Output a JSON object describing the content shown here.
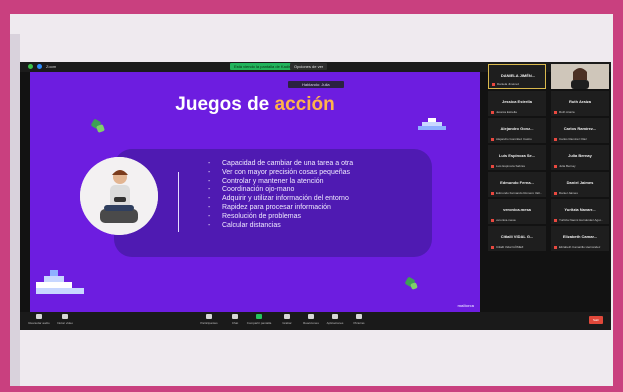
{
  "zoom": {
    "meeting_info": "Zoom",
    "share_banner": "Está viendo la pantalla de Kadiraliyah",
    "view_options": "Opciones de ver",
    "view_label": "Vista",
    "speaker_tag": "Hablando: Julia",
    "toolbar": {
      "items": [
        "Reanudar audio",
        "Iniciar video",
        "Participantes",
        "Chat",
        "Compartir pantalla",
        "Grabar",
        "Reacciones",
        "Aplicaciones",
        "Pizarras"
      ],
      "end": "Salir"
    }
  },
  "slide": {
    "title_main": "Juegos de ",
    "title_accent": "acción",
    "bullets": [
      "Capacidad de cambiar de una tarea a otra",
      "Ver con mayor precisión cosas pequeñas",
      "Controlar y mantener la atención",
      "Coordinación ojo-mano",
      "Adquirir y utilizar información del entorno",
      "Rapidez para procesar información",
      "Resolución de problemas",
      "Calcular distancias"
    ],
    "watermark": "mallorca"
  },
  "gallery": {
    "tiles": [
      {
        "name": "DANIELA JIMÉN...",
        "sub": "Daniela Jiménez"
      },
      {
        "name": "",
        "sub": ""
      },
      {
        "name": "Jessica Estrella",
        "sub": "Jessica Estrella"
      },
      {
        "name": "Ruth Araiza",
        "sub": "Ruth Araiza"
      },
      {
        "name": "Alejandro Gonz...",
        "sub": "Alejandro González Castro"
      },
      {
        "name": "Carlos Ramírez...",
        "sub": "Carlos Ramírez Olaz"
      },
      {
        "name": "Luis Espinoza Se...",
        "sub": "Luis Espinoza Sabrés"
      },
      {
        "name": "Julia Bernay",
        "sub": "Julia Bernay"
      },
      {
        "name": "Edmundo Ferna...",
        "sub": "Edmundo Fernando Romero Vall..."
      },
      {
        "name": "Daniel Jaimes",
        "sub": "Daniel Jaimes"
      },
      {
        "name": "veronica.mesa",
        "sub": "veronica.mesa"
      },
      {
        "name": "Yuritzia Navarr...",
        "sub": "Yuritzia Naomi Hernández Agui..."
      },
      {
        "name": "Citlalli VIDAL G...",
        "sub": "Citlalli Vidal GÓMEZ"
      },
      {
        "name": "Elizabeth Camar...",
        "sub": "Elizabeth Camarillo Hernández"
      }
    ]
  }
}
